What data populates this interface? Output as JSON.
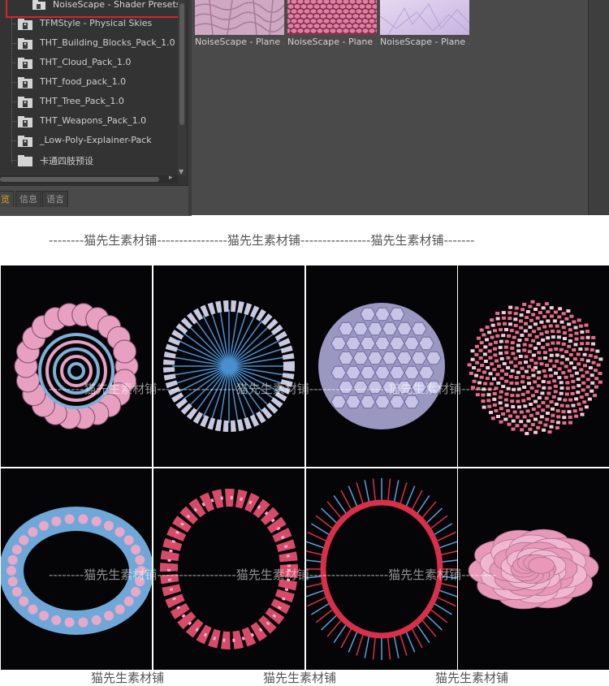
{
  "tree": {
    "selected_item": "NoiseScape - Shader Presets",
    "items": [
      "TFMStyle - Physical Skies",
      "THT_Building_Blocks_Pack_1.0",
      "THT_Cloud_Pack_1.0",
      "THT_food_pack_1.0",
      "THT_Tree_Pack_1.0",
      "THT_Weapons_Pack_1.0",
      "_Low-Poly-Explainer-Pack",
      "卡通四肢预设"
    ]
  },
  "tabs": [
    "览",
    "信息",
    "语言"
  ],
  "thumbnails": [
    {
      "caption": "NoiseScape - Plane ..."
    },
    {
      "caption": "NoiseScape - Plane ..."
    },
    {
      "caption": "NoiseScape - Plane ..."
    }
  ],
  "watermark": {
    "line": "--------猫先生素材铺----------------猫先生素材铺----------------猫先生素材铺-------",
    "brand": "猫先生素材铺",
    "overlay_row1": "--------猫先生素材铺------------------猫先生素材铺------------------猫先生素材铺--------",
    "overlay_row2": "--------猫先生素材铺------------------猫先生素材铺------------------猫先生素材铺--------"
  },
  "renders": [
    {
      "name": "render-spiral-disc",
      "colors": [
        "#e8a0c0",
        "#7fb0d8"
      ]
    },
    {
      "name": "render-blue-fan",
      "colors": [
        "#c8c8e0",
        "#4a8fd0"
      ]
    },
    {
      "name": "render-hex-sphere",
      "colors": [
        "#c8c4e8",
        "#6fa0d0"
      ]
    },
    {
      "name": "render-red-pixel-ball",
      "colors": [
        "#e86a8a",
        "#f4c8d8"
      ]
    },
    {
      "name": "render-blue-torus",
      "colors": [
        "#6fa8d8",
        "#e8a8c8"
      ]
    },
    {
      "name": "render-red-ring",
      "colors": [
        "#d84a6a",
        "#f0b0c8"
      ]
    },
    {
      "name": "render-spike-ring",
      "colors": [
        "#d8304a",
        "#5aa0e0"
      ]
    },
    {
      "name": "render-pink-flower",
      "colors": [
        "#f0b8d0",
        "#e898b8"
      ]
    }
  ]
}
